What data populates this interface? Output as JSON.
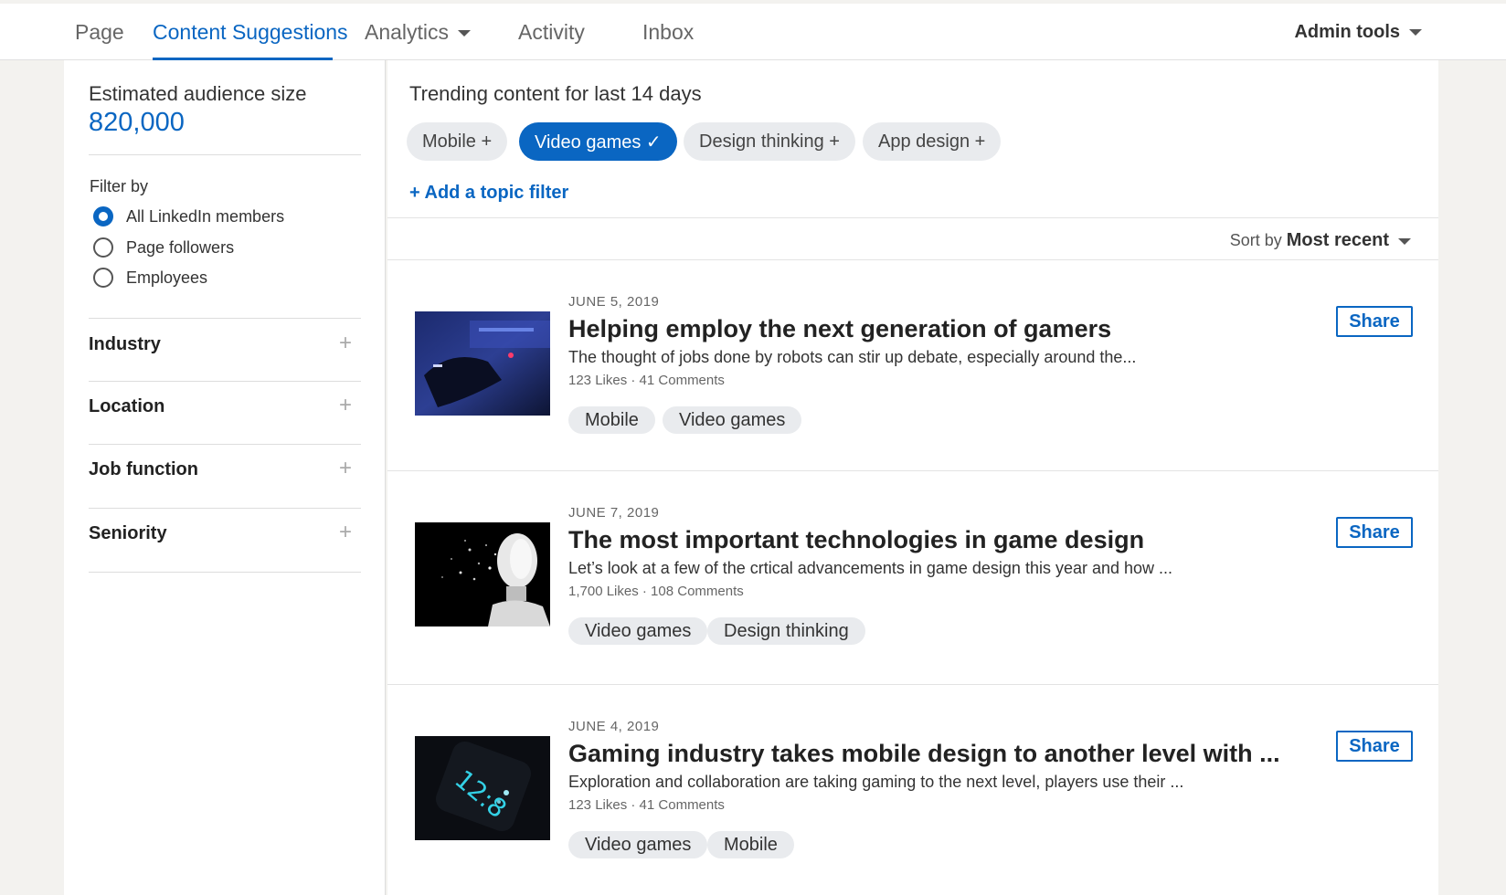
{
  "nav": {
    "tabs": [
      {
        "label": "Page"
      },
      {
        "label": "Content Suggestions"
      },
      {
        "label": "Analytics"
      },
      {
        "label": "Activity"
      },
      {
        "label": "Inbox"
      }
    ],
    "admin_tools": "Admin tools",
    "accent": "#0a66c2"
  },
  "sidebar": {
    "audience_label": "Estimated audience size",
    "audience_value": "820,000",
    "filter_by": "Filter by",
    "radios": [
      {
        "label": "All LinkedIn members",
        "checked": true
      },
      {
        "label": "Page followers",
        "checked": false
      },
      {
        "label": "Employees",
        "checked": false
      }
    ],
    "facets": [
      {
        "label": "Industry"
      },
      {
        "label": "Location"
      },
      {
        "label": "Job function"
      },
      {
        "label": "Seniority"
      }
    ]
  },
  "main": {
    "trending_title": "Trending content for last 14 days",
    "topic_pills": [
      {
        "label": "Mobile +",
        "selected": false
      },
      {
        "label": "Video games ✓",
        "selected": true
      },
      {
        "label": "Design thinking +",
        "selected": false
      },
      {
        "label": "App design +",
        "selected": false
      }
    ],
    "add_topic": "+ Add a topic filter",
    "sort_prefix": "Sort by",
    "sort_value": "Most recent",
    "share_label": "Share",
    "cards": [
      {
        "date": "JUNE 5, 2019",
        "title": "Helping employ the next generation of gamers",
        "desc": "The thought of jobs done by robots can stir up debate, especially around the...",
        "stats": "123 Likes · 41 Comments",
        "tags": [
          "Mobile",
          "Video games"
        ],
        "thumb_icon": "gaming-keyboard-image"
      },
      {
        "date": "JUNE 7, 2019",
        "title": "The most important technologies in game design",
        "desc": "Let’s look at a few of the crtical advancements in game design this year and how ...",
        "stats": "1,700 Likes · 108 Comments",
        "tags": [
          "Video games",
          "Design thinking"
        ],
        "thumb_icon": "robot-head-image"
      },
      {
        "date": "JUNE 4, 2019",
        "title": "Gaming industry takes mobile design to another level with ...",
        "desc": "Exploration and collaboration are taking gaming to the next level, players use their ...",
        "stats": "123 Likes · 41 Comments",
        "tags": [
          "Video games",
          "Mobile"
        ],
        "thumb_icon": "smartwatch-image"
      }
    ]
  }
}
